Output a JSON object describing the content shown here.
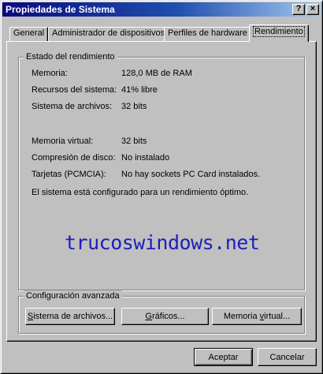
{
  "window": {
    "title": "Propiedades de Sistema"
  },
  "titlebar": {
    "help_glyph": "?",
    "close_glyph": "×"
  },
  "tabs": [
    {
      "label": "General"
    },
    {
      "label": "Administrador de dispositivos"
    },
    {
      "label": "Perfiles de hardware"
    },
    {
      "label": "Rendimiento",
      "active": true
    }
  ],
  "performance": {
    "group_label": "Estado del rendimiento",
    "rows": [
      {
        "label": "Memoria:",
        "value": "128,0 MB de RAM"
      },
      {
        "label": "Recursos del sistema:",
        "value": "41% libre"
      },
      {
        "label": "Sistema de archivos:",
        "value": "32 bits"
      },
      {
        "label": "Memoria virtual:",
        "value": "32 bits"
      },
      {
        "label": "Compresión de disco:",
        "value": "No instalado"
      },
      {
        "label": "Tarjetas (PCMCIA):",
        "value": "No hay sockets PC Card instalados."
      }
    ],
    "status_message": "El sistema está configurado para un rendimiento óptimo."
  },
  "watermark": "trucoswindows.net",
  "advanced": {
    "group_label": "Configuración avanzada",
    "buttons": {
      "filesystem": {
        "accel": "S",
        "rest": "istema de archivos..."
      },
      "graphics": {
        "accel": "G",
        "rest": "ráficos..."
      },
      "virtual_memory": {
        "pre": "Memoria ",
        "accel": "v",
        "rest": "irtual..."
      }
    }
  },
  "footer": {
    "ok_label": "Aceptar",
    "cancel_label": "Cancelar"
  }
}
